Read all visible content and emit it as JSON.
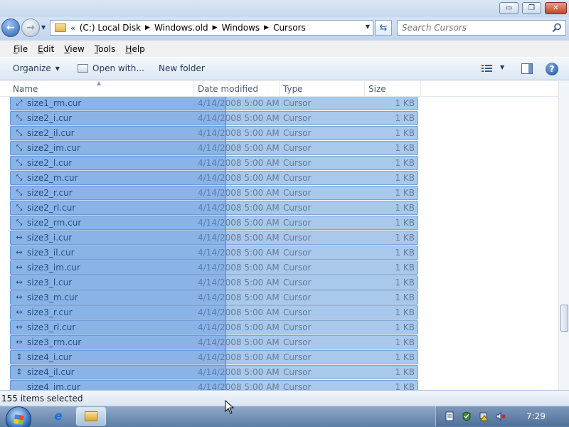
{
  "window": {
    "buttons": {
      "minimize": "▭",
      "maximize": "❐",
      "close": "✕"
    }
  },
  "address": {
    "chevrons": "«",
    "crumbs": [
      "(C:) Local Disk",
      "Windows.old",
      "Windows",
      "Cursors"
    ],
    "search_placeholder": "Search Cursors"
  },
  "menu": {
    "items": [
      {
        "first": "F",
        "rest": "ile"
      },
      {
        "first": "E",
        "rest": "dit"
      },
      {
        "first": "V",
        "rest": "iew"
      },
      {
        "first": "T",
        "rest": "ools"
      },
      {
        "first": "H",
        "rest": "elp"
      }
    ]
  },
  "toolbar": {
    "organize": "Organize",
    "open_with": "Open with...",
    "new_folder": "New folder"
  },
  "columns": {
    "name": "Name",
    "date": "Date modified",
    "type": "Type",
    "size": "Size"
  },
  "files": [
    {
      "name": "size1_rm.cur",
      "date": "4/14/2008 5:00 AM",
      "type": "Cursor",
      "size": "1 KB",
      "glyph": "⤢"
    },
    {
      "name": "size2_i.cur",
      "date": "4/14/2008 5:00 AM",
      "type": "Cursor",
      "size": "1 KB",
      "glyph": "⤡"
    },
    {
      "name": "size2_il.cur",
      "date": "4/14/2008 5:00 AM",
      "type": "Cursor",
      "size": "1 KB",
      "glyph": "⤡"
    },
    {
      "name": "size2_im.cur",
      "date": "4/14/2008 5:00 AM",
      "type": "Cursor",
      "size": "1 KB",
      "glyph": "⤡"
    },
    {
      "name": "size2_l.cur",
      "date": "4/14/2008 5:00 AM",
      "type": "Cursor",
      "size": "1 KB",
      "glyph": "⤡"
    },
    {
      "name": "size2_m.cur",
      "date": "4/14/2008 5:00 AM",
      "type": "Cursor",
      "size": "1 KB",
      "glyph": "⤡"
    },
    {
      "name": "size2_r.cur",
      "date": "4/14/2008 5:00 AM",
      "type": "Cursor",
      "size": "1 KB",
      "glyph": "⤡"
    },
    {
      "name": "size2_rl.cur",
      "date": "4/14/2008 5:00 AM",
      "type": "Cursor",
      "size": "1 KB",
      "glyph": "⤡"
    },
    {
      "name": "size2_rm.cur",
      "date": "4/14/2008 5:00 AM",
      "type": "Cursor",
      "size": "1 KB",
      "glyph": "⤡"
    },
    {
      "name": "size3_i.cur",
      "date": "4/14/2008 5:00 AM",
      "type": "Cursor",
      "size": "1 KB",
      "glyph": "↔"
    },
    {
      "name": "size3_il.cur",
      "date": "4/14/2008 5:00 AM",
      "type": "Cursor",
      "size": "1 KB",
      "glyph": "↔"
    },
    {
      "name": "size3_im.cur",
      "date": "4/14/2008 5:00 AM",
      "type": "Cursor",
      "size": "1 KB",
      "glyph": "↔"
    },
    {
      "name": "size3_l.cur",
      "date": "4/14/2008 5:00 AM",
      "type": "Cursor",
      "size": "1 KB",
      "glyph": "↔"
    },
    {
      "name": "size3_m.cur",
      "date": "4/14/2008 5:00 AM",
      "type": "Cursor",
      "size": "1 KB",
      "glyph": "↔"
    },
    {
      "name": "size3_r.cur",
      "date": "4/14/2008 5:00 AM",
      "type": "Cursor",
      "size": "1 KB",
      "glyph": "↔"
    },
    {
      "name": "size3_rl.cur",
      "date": "4/14/2008 5:00 AM",
      "type": "Cursor",
      "size": "1 KB",
      "glyph": "↔"
    },
    {
      "name": "size3_rm.cur",
      "date": "4/14/2008 5:00 AM",
      "type": "Cursor",
      "size": "1 KB",
      "glyph": "↔"
    },
    {
      "name": "size4_i.cur",
      "date": "4/14/2008 5:00 AM",
      "type": "Cursor",
      "size": "1 KB",
      "glyph": "↕"
    },
    {
      "name": "size4_il.cur",
      "date": "4/14/2008 5:00 AM",
      "type": "Cursor",
      "size": "1 KB",
      "glyph": "↕"
    },
    {
      "name": "size4_im.cur",
      "date": "4/14/2008 5:00 AM",
      "type": "Cursor",
      "size": "1 KB",
      "glyph": ""
    }
  ],
  "status": {
    "text": "155 items selected"
  },
  "taskbar": {
    "clock": "7:29",
    "ie_glyph": "e"
  },
  "colors": {
    "selection": "#a8c8ec",
    "selection_border": "#7da2ce",
    "accent": "#1e395b"
  }
}
